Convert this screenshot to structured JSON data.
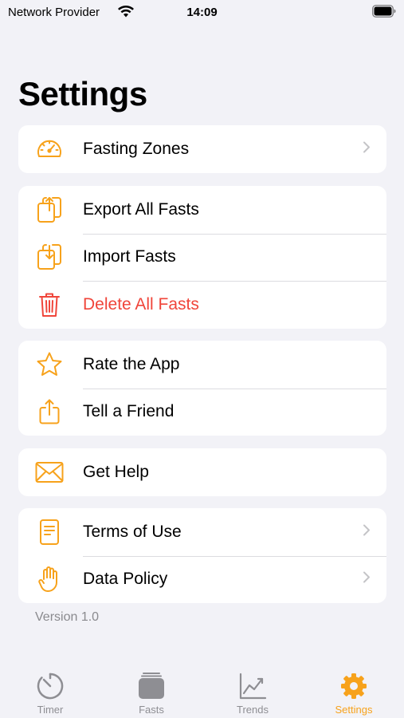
{
  "status_bar": {
    "carrier": "Network Provider",
    "time": "14:09"
  },
  "page": {
    "title": "Settings"
  },
  "accent_color": "#f7a21b",
  "destructive_color": "#f0453a",
  "groups": [
    {
      "items": [
        {
          "label": "Fasting Zones",
          "icon": "speedometer-icon",
          "chevron": true
        }
      ]
    },
    {
      "items": [
        {
          "label": "Export All Fasts",
          "icon": "export-icon",
          "chevron": false
        },
        {
          "label": "Import Fasts",
          "icon": "import-icon",
          "chevron": false
        },
        {
          "label": "Delete All Fasts",
          "icon": "trash-icon",
          "chevron": false,
          "destructive": true
        }
      ]
    },
    {
      "items": [
        {
          "label": "Rate the App",
          "icon": "star-icon",
          "chevron": false
        },
        {
          "label": "Tell a Friend",
          "icon": "share-icon",
          "chevron": false
        }
      ]
    },
    {
      "items": [
        {
          "label": "Get Help",
          "icon": "envelope-icon",
          "chevron": false
        }
      ]
    },
    {
      "items": [
        {
          "label": "Terms of Use",
          "icon": "document-icon",
          "chevron": true
        },
        {
          "label": "Data Policy",
          "icon": "hand-icon",
          "chevron": true
        }
      ]
    }
  ],
  "footer": {
    "version": "Version 1.0"
  },
  "tab_bar": {
    "tabs": [
      {
        "label": "Timer",
        "icon": "timer-icon",
        "active": false
      },
      {
        "label": "Fasts",
        "icon": "stack-icon",
        "active": false
      },
      {
        "label": "Trends",
        "icon": "chart-icon",
        "active": false
      },
      {
        "label": "Settings",
        "icon": "gear-icon",
        "active": true
      }
    ]
  }
}
